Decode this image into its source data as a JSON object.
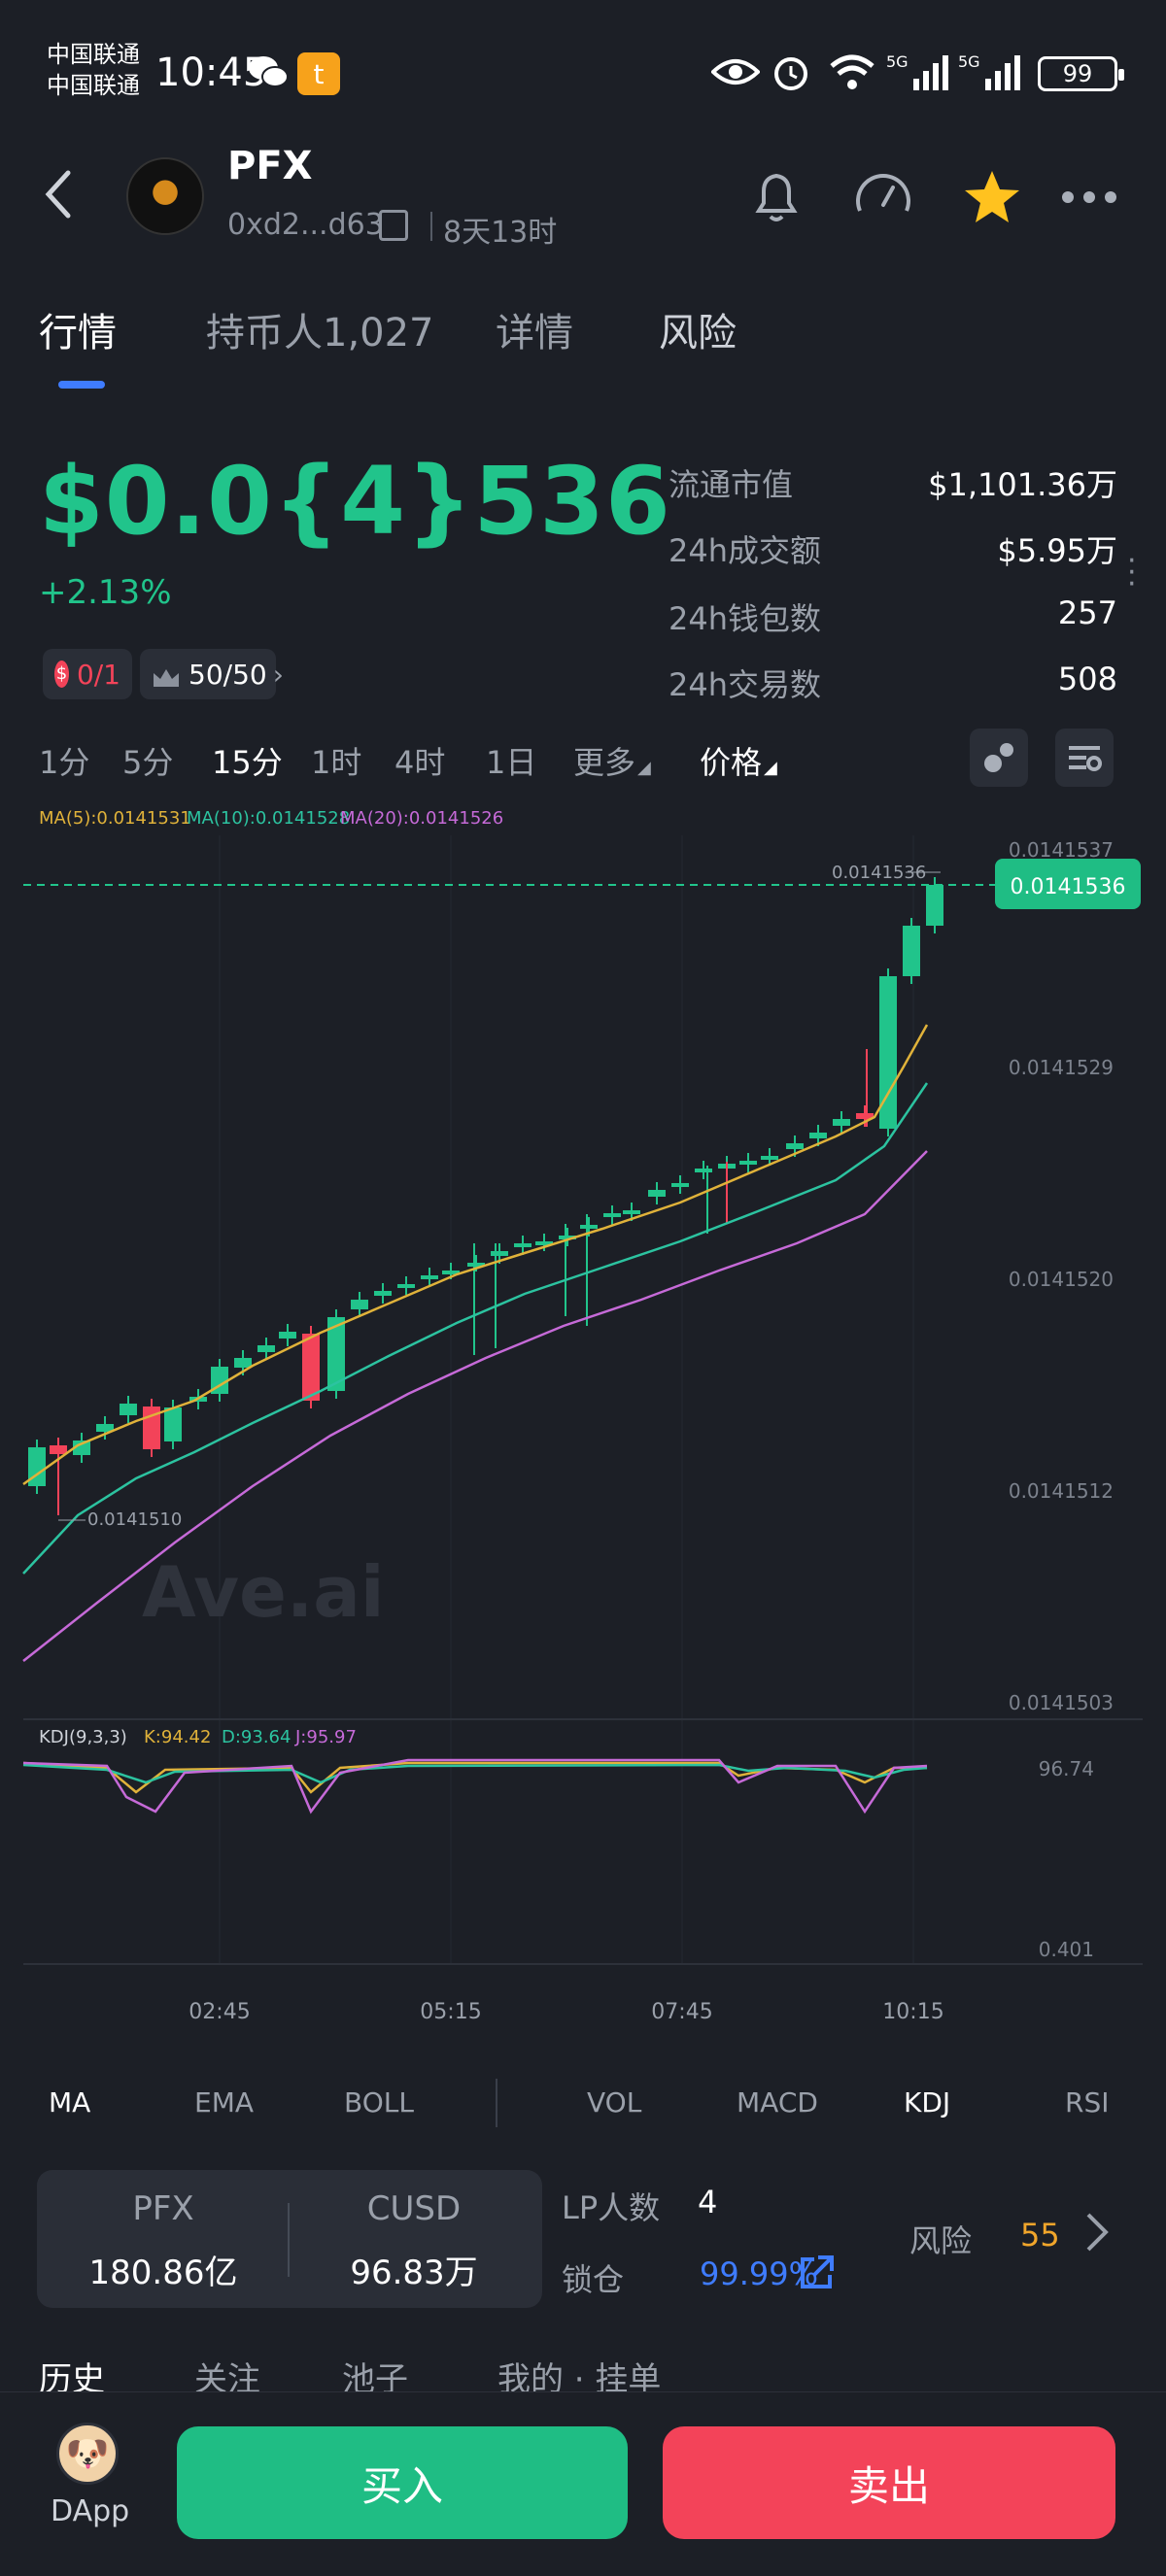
{
  "status_bar": {
    "carrier_1": "中国联通",
    "carrier_2": "中国联通",
    "time": "10:45",
    "battery": "99",
    "icons": [
      "wechat-icon",
      "taobao-icon",
      "eye-icon",
      "alarm-icon",
      "wifi-icon",
      "5g-signal-icon",
      "5g-signal-icon",
      "battery-icon"
    ]
  },
  "header": {
    "token_name": "PFX",
    "address": "0xd2...d63c",
    "age": "8天13时",
    "icons": [
      "back-icon",
      "bell-icon",
      "gauge-icon",
      "star-icon",
      "more-icon"
    ]
  },
  "top_tabs": [
    {
      "label": "行情",
      "active": true
    },
    {
      "label": "持币人1,027",
      "active": false
    },
    {
      "label": "详情",
      "active": false
    },
    {
      "label": "风险",
      "active": false
    }
  ],
  "price": {
    "value": "$0.0{4}536",
    "change": "+2.13%",
    "badge_1": "0/1",
    "badge_2": "50/50"
  },
  "stats": [
    {
      "label": "流通市值",
      "value": "$1,101.36万"
    },
    {
      "label": "24h成交额",
      "value": "$5.95万"
    },
    {
      "label": "24h钱包数",
      "value": "257"
    },
    {
      "label": "24h交易数",
      "value": "508"
    }
  ],
  "timeframes": [
    "1分",
    "5分",
    "15分",
    "1时",
    "4时",
    "1日",
    "更多",
    "价格"
  ],
  "selected_timeframe": "15分",
  "ma_legend": {
    "ma5": "MA(5):0.0141531",
    "ma10": "MA(10):0.0141528",
    "ma20": "MA(20):0.0141526"
  },
  "chart": {
    "watermark": "Ave.ai",
    "high_label": "0.0141536",
    "low_label": "0.0141510",
    "current_price_tag": "0.0141536",
    "y_ticks": [
      "0.0141537",
      "0.0141529",
      "0.0141520",
      "0.0141512",
      "0.0141503"
    ],
    "x_ticks": [
      "02:45",
      "05:15",
      "07:45",
      "10:15"
    ],
    "kdj_legend": {
      "name": "KDJ(9,3,3)",
      "k": "K:94.42",
      "d": "D:93.64",
      "j": "J:95.97"
    },
    "kdj_ticks": [
      "96.74",
      "0.401"
    ],
    "colors": {
      "up": "#21c48b",
      "down": "#f34359",
      "ma5": "#e0b23a",
      "ma10": "#2cc3a0",
      "ma20": "#c66ad8"
    }
  },
  "chart_data": {
    "type": "candlestick",
    "title": "",
    "xlabel": "",
    "ylabel": "",
    "ylim": [
      0.0141503,
      0.0141537
    ],
    "x_ticks": [
      "02:45",
      "05:15",
      "07:45",
      "10:15"
    ],
    "series": [
      {
        "name": "MA(5)",
        "last": 0.0141531
      },
      {
        "name": "MA(10)",
        "last": 0.0141528
      },
      {
        "name": "MA(20)",
        "last": 0.0141526
      }
    ],
    "annotations": [
      {
        "label": "0.0141510"
      },
      {
        "label": "0.0141536"
      }
    ]
  },
  "indicator_tabs": [
    "MA",
    "EMA",
    "BOLL",
    "VOL",
    "MACD",
    "KDJ",
    "RSI"
  ],
  "selected_indicator": "KDJ",
  "pool": {
    "token_symbol": "PFX",
    "token_amount": "180.86亿",
    "quote_symbol": "CUSD",
    "quote_amount": "96.83万",
    "lp_label": "LP人数",
    "lp_count": "4",
    "lock_label": "锁仓",
    "lock_value": "99.99%",
    "risk_label": "风险",
    "risk_value": "55"
  },
  "bottom_tabs": [
    "历史",
    "关注",
    "池子",
    "我的 · 挂单"
  ],
  "footer": {
    "dapp_label": "DApp",
    "buy_label": "买入",
    "sell_label": "卖出"
  }
}
